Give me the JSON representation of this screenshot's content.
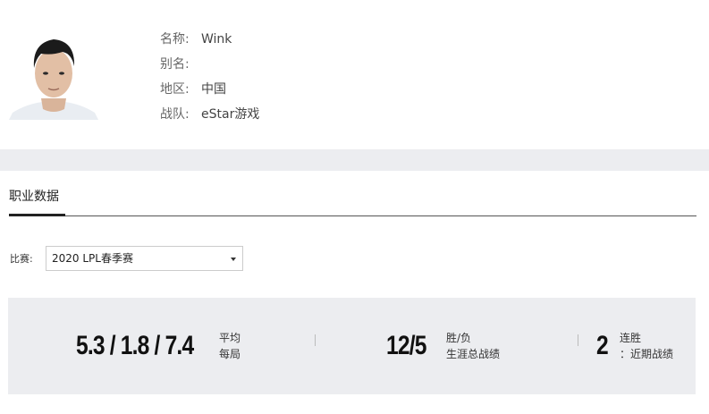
{
  "player": {
    "name_label": "名称:",
    "name_value": "Wink",
    "alias_label": "别名:",
    "alias_value": "",
    "region_label": "地区:",
    "region_value": "中国",
    "team_label": "战队:",
    "team_value": "eStar游戏"
  },
  "section": {
    "tab_label": "职业数据"
  },
  "filter": {
    "label": "比赛:",
    "selected": "2020 LPL春季赛"
  },
  "stats": {
    "kda_value": "5.3 / 1.8 / 7.4",
    "kda_caption_1": "平均",
    "kda_caption_2": "每局",
    "record_value": "12/5",
    "record_caption_1": "胜/负",
    "record_caption_2": "生涯总战绩",
    "streak_value": "2",
    "streak_caption_1": "连胜",
    "streak_caption_2": "：近期战绩"
  },
  "colors": {
    "band": "#ecedf0",
    "text_dark": "#111111",
    "accent_line": "#222222"
  }
}
